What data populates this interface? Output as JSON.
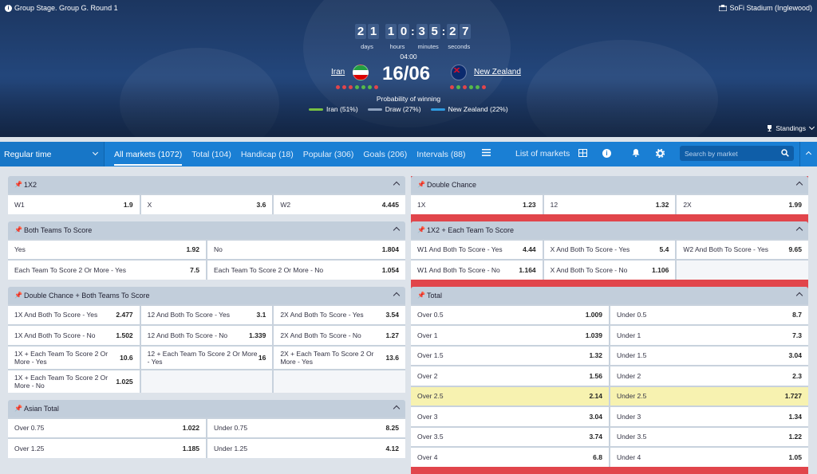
{
  "header": {
    "stage": "Group Stage. Group G. Round 1",
    "venue": "SoFi Stadium (Inglewood)",
    "timer": {
      "days": [
        "2",
        "1"
      ],
      "hours": [
        "1",
        "0"
      ],
      "minutes": [
        "3",
        "5"
      ],
      "seconds": [
        "2",
        "7"
      ],
      "labels": {
        "days": "days",
        "hours": "hours",
        "minutes": "minutes",
        "seconds": "seconds"
      }
    },
    "kickoff_time": "04:00",
    "team1": "Iran",
    "team2": "New Zealand",
    "date": "16/06",
    "prob_title": "Probability of winning",
    "probs": [
      {
        "label": "Iran (51%)",
        "color": "#78c042"
      },
      {
        "label": "Draw (27%)",
        "color": "#8fa3bf"
      },
      {
        "label": "New Zealand (22%)",
        "color": "#2f9be0"
      }
    ],
    "standings": "Standings"
  },
  "nav": {
    "period": "Regular time",
    "tabs": [
      "All markets (1072)",
      "Total (104)",
      "Handicap (18)",
      "Popular (306)",
      "Goals (206)",
      "Intervals (88)"
    ],
    "list_markets": "List of markets",
    "search_placeholder": "Search by market"
  },
  "left": [
    {
      "title": "1X2",
      "cols": 3,
      "cells": [
        [
          "W1",
          "1.9"
        ],
        [
          "X",
          "3.6"
        ],
        [
          "W2",
          "4.445"
        ]
      ]
    },
    {
      "title": "Both Teams To Score",
      "cols": 2,
      "cells": [
        [
          "Yes",
          "1.92"
        ],
        [
          "No",
          "1.804"
        ],
        [
          "Each Team To Score 2 Or More - Yes",
          "7.5"
        ],
        [
          "Each Team To Score 2 Or More - No",
          "1.054"
        ]
      ]
    },
    {
      "title": "Double Chance + Both Teams To Score",
      "cols": 3,
      "cells": [
        [
          "1X And Both To Score - Yes",
          "2.477"
        ],
        [
          "12 And Both To Score - Yes",
          "3.1"
        ],
        [
          "2X And Both To Score - Yes",
          "3.54"
        ],
        [
          "1X And Both To Score - No",
          "1.502"
        ],
        [
          "12 And Both To Score - No",
          "1.339"
        ],
        [
          "2X And Both To Score - No",
          "1.27"
        ],
        [
          "1X + Each Team To Score 2 Or More - Yes",
          "10.6"
        ],
        [
          "12 + Each Team To Score 2 Or More - Yes",
          "16"
        ],
        [
          "2X + Each Team To Score 2 Or More - Yes",
          "13.6"
        ],
        [
          "1X + Each Team To Score 2 Or More - No",
          "1.025"
        ],
        [
          "",
          ""
        ],
        [
          "",
          ""
        ]
      ]
    },
    {
      "title": "Asian Total",
      "cols": 2,
      "cells": [
        [
          "Over 0.75",
          "1.022"
        ],
        [
          "Under 0.75",
          "8.25"
        ],
        [
          "Over 1.25",
          "1.185"
        ],
        [
          "Under 1.25",
          "4.12"
        ]
      ]
    }
  ],
  "right": [
    {
      "title": "Double Chance",
      "cols": 3,
      "cells": [
        [
          "1X",
          "1.23"
        ],
        [
          "12",
          "1.32"
        ],
        [
          "2X",
          "1.99"
        ]
      ]
    },
    {
      "title": "1X2 + Each Team To Score",
      "cols": 3,
      "cells": [
        [
          "W1 And Both To Score - Yes",
          "4.44"
        ],
        [
          "X And Both To Score - Yes",
          "5.4"
        ],
        [
          "W2 And Both To Score - Yes",
          "9.65"
        ],
        [
          "W1 And Both To Score - No",
          "1.164"
        ],
        [
          "X And Both To Score - No",
          "1.106"
        ],
        [
          "",
          ""
        ]
      ]
    },
    {
      "title": "Total",
      "cols": 2,
      "cells": [
        [
          "Over 0.5",
          "1.009"
        ],
        [
          "Under 0.5",
          "8.7"
        ],
        [
          "Over 1",
          "1.039"
        ],
        [
          "Under 1",
          "7.3"
        ],
        [
          "Over 1.5",
          "1.32"
        ],
        [
          "Under 1.5",
          "3.04"
        ],
        [
          "Over 2",
          "1.56"
        ],
        [
          "Under 2",
          "2.3"
        ],
        [
          "Over 2.5",
          "2.14"
        ],
        [
          "Under 2.5",
          "1.727"
        ],
        [
          "Over 3",
          "3.04"
        ],
        [
          "Under 3",
          "1.34"
        ],
        [
          "Over 3.5",
          "3.74"
        ],
        [
          "Under 3.5",
          "1.22"
        ],
        [
          "Over 4",
          "6.8"
        ],
        [
          "Under 4",
          "1.05"
        ]
      ],
      "highlight": [
        8,
        9
      ]
    }
  ]
}
